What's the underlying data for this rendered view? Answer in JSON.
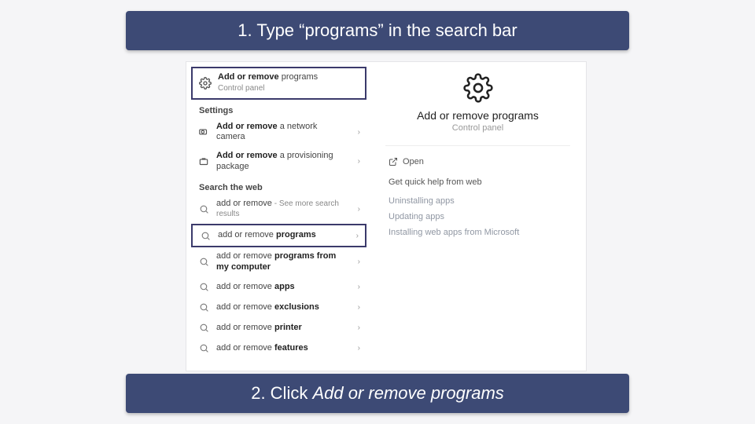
{
  "instruction_top": "1.   Type “programs” in the search bar",
  "instruction_bottom_prefix": "2. Click ",
  "instruction_bottom_em": "Add or remove programs",
  "results": {
    "top": {
      "strong": "Add or remove",
      "rest": " programs",
      "sub": "Control panel"
    },
    "section_settings": "Settings",
    "settings_items": [
      {
        "strong": "Add or remove",
        "rest": " a network camera",
        "icon": "camera"
      },
      {
        "strong": "Add or remove",
        "rest": " a provisioning package",
        "icon": "package"
      }
    ],
    "section_web": "Search the web",
    "web_items": [
      {
        "pre": "add or remove",
        "strong": "",
        "rest": " ‑ See more search results",
        "hint": true
      },
      {
        "pre": "add or remove ",
        "strong": "programs",
        "rest": "",
        "highlighted": true
      },
      {
        "pre": "add or remove ",
        "strong": "programs from my computer",
        "rest": ""
      },
      {
        "pre": "add or remove ",
        "strong": "apps",
        "rest": ""
      },
      {
        "pre": "add or remove ",
        "strong": "exclusions",
        "rest": ""
      },
      {
        "pre": "add or remove ",
        "strong": "printer",
        "rest": ""
      },
      {
        "pre": "add or remove ",
        "strong": "features",
        "rest": ""
      }
    ]
  },
  "detail": {
    "title": "Add or remove programs",
    "sub": "Control panel",
    "open": "Open",
    "help_head": "Get quick help from web",
    "links": [
      "Uninstalling apps",
      "Updating apps",
      "Installing web apps from Microsoft"
    ]
  }
}
